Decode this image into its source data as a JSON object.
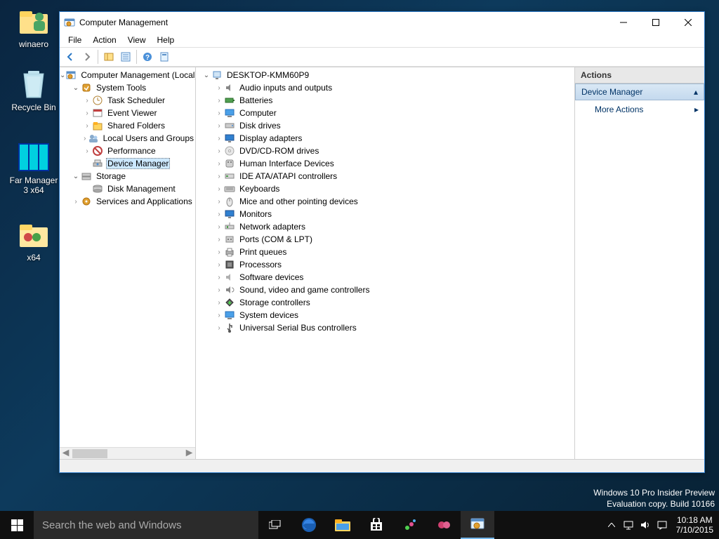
{
  "desktop_icons": [
    {
      "label": "winaero",
      "icon": "user"
    },
    {
      "label": "Recycle Bin",
      "icon": "bin"
    },
    {
      "label": "Far Manager 3 x64",
      "icon": "far"
    },
    {
      "label": "x64",
      "icon": "folder"
    }
  ],
  "window": {
    "title": "Computer Management",
    "menus": [
      "File",
      "Action",
      "View",
      "Help"
    ]
  },
  "tree": {
    "root": "Computer Management (Local)",
    "system_tools": "System Tools",
    "system_children": [
      {
        "label": "Task Scheduler",
        "icon": "clock"
      },
      {
        "label": "Event Viewer",
        "icon": "event"
      },
      {
        "label": "Shared Folders",
        "icon": "share"
      },
      {
        "label": "Local Users and Groups",
        "icon": "users"
      },
      {
        "label": "Performance",
        "icon": "perf"
      },
      {
        "label": "Device Manager",
        "icon": "devmgr",
        "selected": true,
        "no_chev": true
      }
    ],
    "storage": "Storage",
    "storage_children": [
      {
        "label": "Disk Management",
        "icon": "disk",
        "no_chev": true
      }
    ],
    "services": "Services and Applications"
  },
  "devices": {
    "root": "DESKTOP-KMM60P9",
    "items": [
      {
        "label": "Audio inputs and outputs",
        "icon": "audio"
      },
      {
        "label": "Batteries",
        "icon": "battery"
      },
      {
        "label": "Computer",
        "icon": "computer"
      },
      {
        "label": "Disk drives",
        "icon": "diskdrive"
      },
      {
        "label": "Display adapters",
        "icon": "display"
      },
      {
        "label": "DVD/CD-ROM drives",
        "icon": "dvd"
      },
      {
        "label": "Human Interface Devices",
        "icon": "hid"
      },
      {
        "label": "IDE ATA/ATAPI controllers",
        "icon": "ide"
      },
      {
        "label": "Keyboards",
        "icon": "keyboard"
      },
      {
        "label": "Mice and other pointing devices",
        "icon": "mouse"
      },
      {
        "label": "Monitors",
        "icon": "monitor"
      },
      {
        "label": "Network adapters",
        "icon": "network"
      },
      {
        "label": "Ports (COM & LPT)",
        "icon": "port"
      },
      {
        "label": "Print queues",
        "icon": "printer"
      },
      {
        "label": "Processors",
        "icon": "cpu"
      },
      {
        "label": "Software devices",
        "icon": "software"
      },
      {
        "label": "Sound, video and game controllers",
        "icon": "sound"
      },
      {
        "label": "Storage controllers",
        "icon": "storage"
      },
      {
        "label": "System devices",
        "icon": "system"
      },
      {
        "label": "Universal Serial Bus controllers",
        "icon": "usb"
      }
    ]
  },
  "actions": {
    "header": "Actions",
    "section": "Device Manager",
    "more": "More Actions"
  },
  "watermark": {
    "line1": "Windows 10 Pro Insider Preview",
    "line2": "Evaluation copy. Build 10166"
  },
  "taskbar": {
    "search_placeholder": "Search the web and Windows",
    "time": "10:18 AM",
    "date": "7/10/2015"
  }
}
